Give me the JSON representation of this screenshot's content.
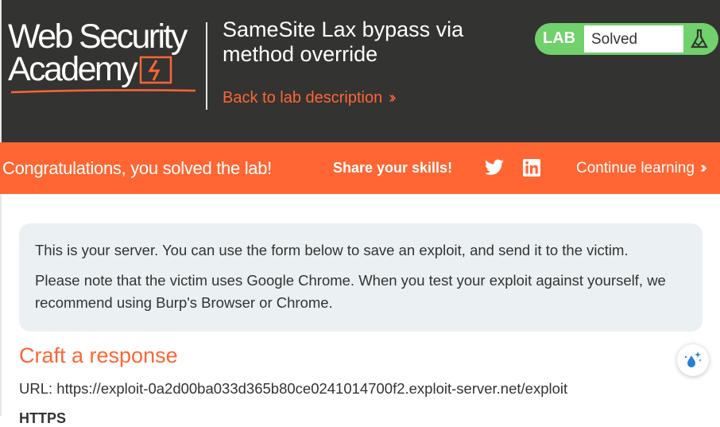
{
  "header": {
    "logo_line1": "Web Security",
    "logo_line2": "Academy",
    "lab_title": "SameSite Lax bypass via method override",
    "back_link": "Back to lab description",
    "status_label": "LAB",
    "status_value": "Solved"
  },
  "banner": {
    "message": "Congratulations, you solved the lab!",
    "share": "Share your skills!",
    "continue": "Continue learning"
  },
  "info": {
    "para1": "This is your server. You can use the form below to save an exploit, and send it to the victim.",
    "para2": "Please note that the victim uses Google Chrome. When you test your exploit against yourself, we recommend using Burp's Browser or Chrome."
  },
  "craft": {
    "title": "Craft a response",
    "url": "URL: https://exploit-0a2d00ba033d365b80ce0241014700f2.exploit-server.net/exploit",
    "next_label": "HTTPS"
  },
  "icons": {
    "twitter": "twitter-icon",
    "linkedin": "linkedin-icon",
    "flask": "flask-icon",
    "logo_bolt": "lightning-bolt-icon",
    "extension": "sparkle-drop-icon"
  },
  "colors": {
    "header_bg": "#333332",
    "accent": "#ff6633",
    "solved_green": "#70d16d",
    "info_bg": "#ebf0f2"
  }
}
